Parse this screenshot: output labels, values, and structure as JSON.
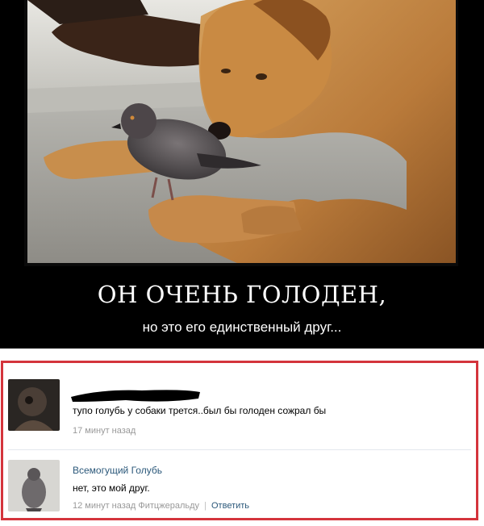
{
  "poster": {
    "title": "ОН ОЧЕНЬ ГОЛОДЕН,",
    "subtitle": "но это его единственный друг..."
  },
  "comments": [
    {
      "author": "",
      "author_redacted": true,
      "text": "тупо голубь у собаки трется..был бы голоден сожрал бы",
      "time": "17 минут назад"
    },
    {
      "author": "Всемогущий Голубь",
      "text": "нет, это мой друг.",
      "time": "12 минут назад",
      "reply_to": "Фитцжеральду",
      "reply_label": "Ответить"
    }
  ],
  "colors": {
    "poster_bg": "#000000",
    "frame_border": "#d4343c",
    "link": "#2b587a",
    "meta": "#999999"
  }
}
